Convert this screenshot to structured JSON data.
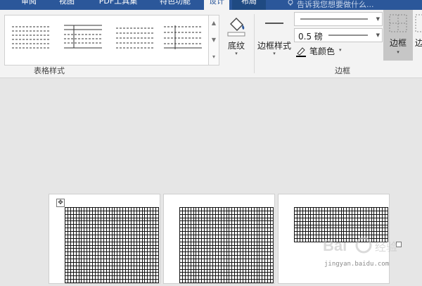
{
  "tabs": [
    {
      "label": "审阅"
    },
    {
      "label": "视图"
    },
    {
      "label": "PDF工具集"
    },
    {
      "label": "特色功能"
    },
    {
      "label": "设计"
    },
    {
      "label": "布局"
    }
  ],
  "tell_me": "告诉我您想要做什么...",
  "ribbon": {
    "table_styles_group": "表格样式",
    "shading_label": "底纹",
    "border_styles_label": "边框样式",
    "pen_weight": "0.5 磅",
    "pen_color_label": "笔颜色",
    "borders_button_label": "边框",
    "borders_group": "边框",
    "partial_label": "边"
  },
  "watermark": {
    "text": "jingyan.baidu.com",
    "brand": "Bai du 经验"
  },
  "colors": {
    "tab_bar": "#2b579a",
    "ribbon_bg": "#f3f3f3",
    "doc_bg": "#e6e6e6",
    "pressed_button": "#c6c6c6"
  }
}
